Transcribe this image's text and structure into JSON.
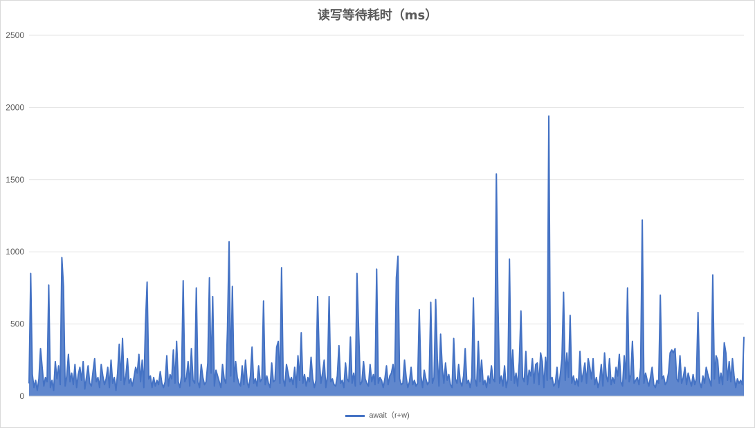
{
  "chart_data": {
    "type": "line",
    "title": "读写等待耗时（ms）",
    "xlabel": "",
    "ylabel": "",
    "ylim": [
      0,
      2500
    ],
    "yticks": [
      0,
      500,
      1000,
      1500,
      2000,
      2500
    ],
    "grid": true,
    "legend_position": "bottom",
    "series_color": "#4472C4",
    "series": [
      {
        "name": "await（r+w)",
        "values": [
          90,
          850,
          150,
          60,
          110,
          40,
          120,
          330,
          200,
          70,
          130,
          100,
          770,
          60,
          110,
          40,
          240,
          120,
          210,
          80,
          960,
          760,
          70,
          140,
          290,
          100,
          160,
          80,
          220,
          60,
          150,
          200,
          110,
          240,
          50,
          130,
          210,
          90,
          70,
          170,
          260,
          100,
          130,
          60,
          220,
          140,
          80,
          120,
          200,
          60,
          250,
          90,
          130,
          40,
          160,
          360,
          110,
          400,
          80,
          140,
          260,
          90,
          120,
          70,
          130,
          200,
          160,
          290,
          100,
          250,
          60,
          500,
          790,
          120,
          140,
          60,
          130,
          70,
          110,
          80,
          170,
          90,
          60,
          100,
          280,
          70,
          150,
          120,
          320,
          90,
          380,
          100,
          60,
          140,
          800,
          100,
          130,
          240,
          70,
          330,
          110,
          90,
          750,
          100,
          60,
          220,
          130,
          80,
          100,
          230,
          820,
          160,
          690,
          70,
          180,
          140,
          100,
          60,
          220,
          120,
          90,
          460,
          1070,
          140,
          760,
          100,
          240,
          130,
          90,
          70,
          210,
          80,
          250,
          100,
          60,
          140,
          340,
          90,
          120,
          70,
          210,
          100,
          120,
          660,
          80,
          140,
          90,
          60,
          230,
          100,
          110,
          340,
          380,
          90,
          890,
          120,
          70,
          220,
          160,
          100,
          130,
          80,
          200,
          60,
          280,
          110,
          440,
          90,
          150,
          70,
          130,
          100,
          270,
          120,
          60,
          110,
          690,
          260,
          90,
          160,
          250,
          60,
          140,
          690,
          100,
          120,
          80,
          70,
          140,
          350,
          90,
          110,
          60,
          230,
          120,
          100,
          410,
          90,
          160,
          70,
          850,
          470,
          80,
          100,
          240,
          120,
          90,
          70,
          220,
          100,
          150,
          80,
          880,
          90,
          130,
          110,
          60,
          120,
          210,
          80,
          140,
          160,
          220,
          100,
          820,
          970,
          120,
          80,
          90,
          250,
          130,
          60,
          100,
          200,
          80,
          110,
          70,
          90,
          600,
          140,
          60,
          180,
          120,
          80,
          100,
          650,
          90,
          130,
          670,
          260,
          70,
          430,
          200,
          90,
          230,
          110,
          150,
          80,
          60,
          400,
          120,
          90,
          220,
          100,
          70,
          140,
          330,
          90,
          110,
          60,
          130,
          680,
          120,
          70,
          380,
          100,
          250,
          80,
          110,
          60,
          140,
          90,
          210,
          120,
          100,
          1540,
          630,
          90,
          140,
          70,
          210,
          60,
          120,
          950,
          110,
          320,
          90,
          160,
          70,
          240,
          590,
          130,
          100,
          310,
          80,
          180,
          140,
          260,
          90,
          220,
          230,
          80,
          300,
          240,
          60,
          270,
          110,
          1940,
          120,
          130,
          70,
          90,
          200,
          60,
          150,
          260,
          720,
          110,
          300,
          130,
          560,
          90,
          140,
          80,
          120,
          70,
          310,
          100,
          160,
          230,
          90,
          260,
          200,
          120,
          260,
          80,
          130,
          60,
          110,
          220,
          70,
          300,
          140,
          100,
          260,
          80,
          130,
          90,
          200,
          140,
          290,
          100,
          70,
          280,
          120,
          750,
          100,
          150,
          380,
          90,
          110,
          130,
          80,
          200,
          1220,
          90,
          160,
          110,
          70,
          130,
          200,
          80,
          60,
          110,
          90,
          700,
          120,
          140,
          80,
          100,
          160,
          300,
          320,
          300,
          330,
          120,
          100,
          280,
          90,
          130,
          200,
          80,
          160,
          110,
          70,
          150,
          80,
          120,
          580,
          100,
          60,
          140,
          90,
          200,
          150,
          110,
          70,
          840,
          120,
          280,
          250,
          90,
          160,
          80,
          370,
          300,
          110,
          240,
          100,
          260,
          140,
          60,
          120,
          90,
          110,
          80,
          410
        ]
      }
    ],
    "legend": [
      "await（r+w)"
    ]
  }
}
